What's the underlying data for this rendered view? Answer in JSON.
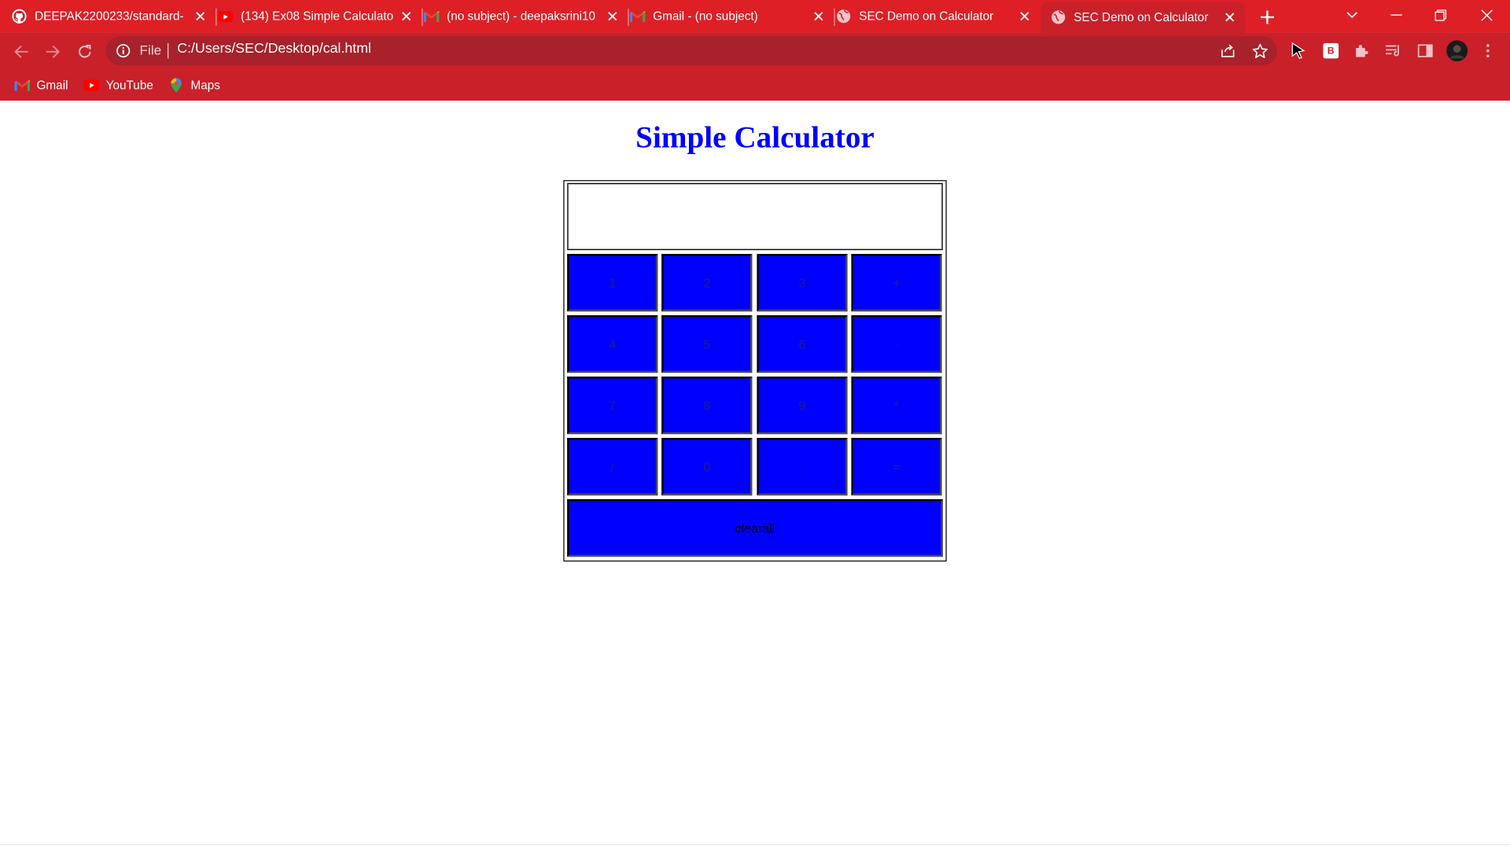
{
  "browser": {
    "tabs": [
      {
        "title": "DEEPAK2200233/standard-",
        "favicon": "github-icon"
      },
      {
        "title": "(134) Ex08 Simple Calculato",
        "favicon": "youtube-icon"
      },
      {
        "title": "(no subject) - deepaksrini10",
        "favicon": "gmail-icon"
      },
      {
        "title": "Gmail - (no subject)",
        "favicon": "gmail-icon"
      },
      {
        "title": "SEC Demo on Calculator",
        "favicon": "globe-icon"
      },
      {
        "title": "SEC Demo on Calculator",
        "favicon": "globe-icon",
        "active": true
      }
    ],
    "address": {
      "scheme_label": "File",
      "url": "C:/Users/SEC/Desktop/cal.html"
    },
    "profile_badge": "B",
    "bookmarks": [
      {
        "label": "Gmail",
        "icon": "gmail-icon"
      },
      {
        "label": "YouTube",
        "icon": "youtube-icon"
      },
      {
        "label": "Maps",
        "icon": "maps-icon"
      }
    ],
    "theme_color": "#de1f26"
  },
  "page": {
    "title": "Simple Calculator",
    "title_color": "#0000ff",
    "display_value": "",
    "button_color": "#0000ff",
    "keys": [
      [
        "1",
        "2",
        "3",
        "+"
      ],
      [
        "4",
        "5",
        "6",
        "-"
      ],
      [
        "7",
        "8",
        "9",
        "*"
      ],
      [
        "/",
        "0",
        ".",
        "="
      ]
    ],
    "clear_label": "clearall"
  }
}
